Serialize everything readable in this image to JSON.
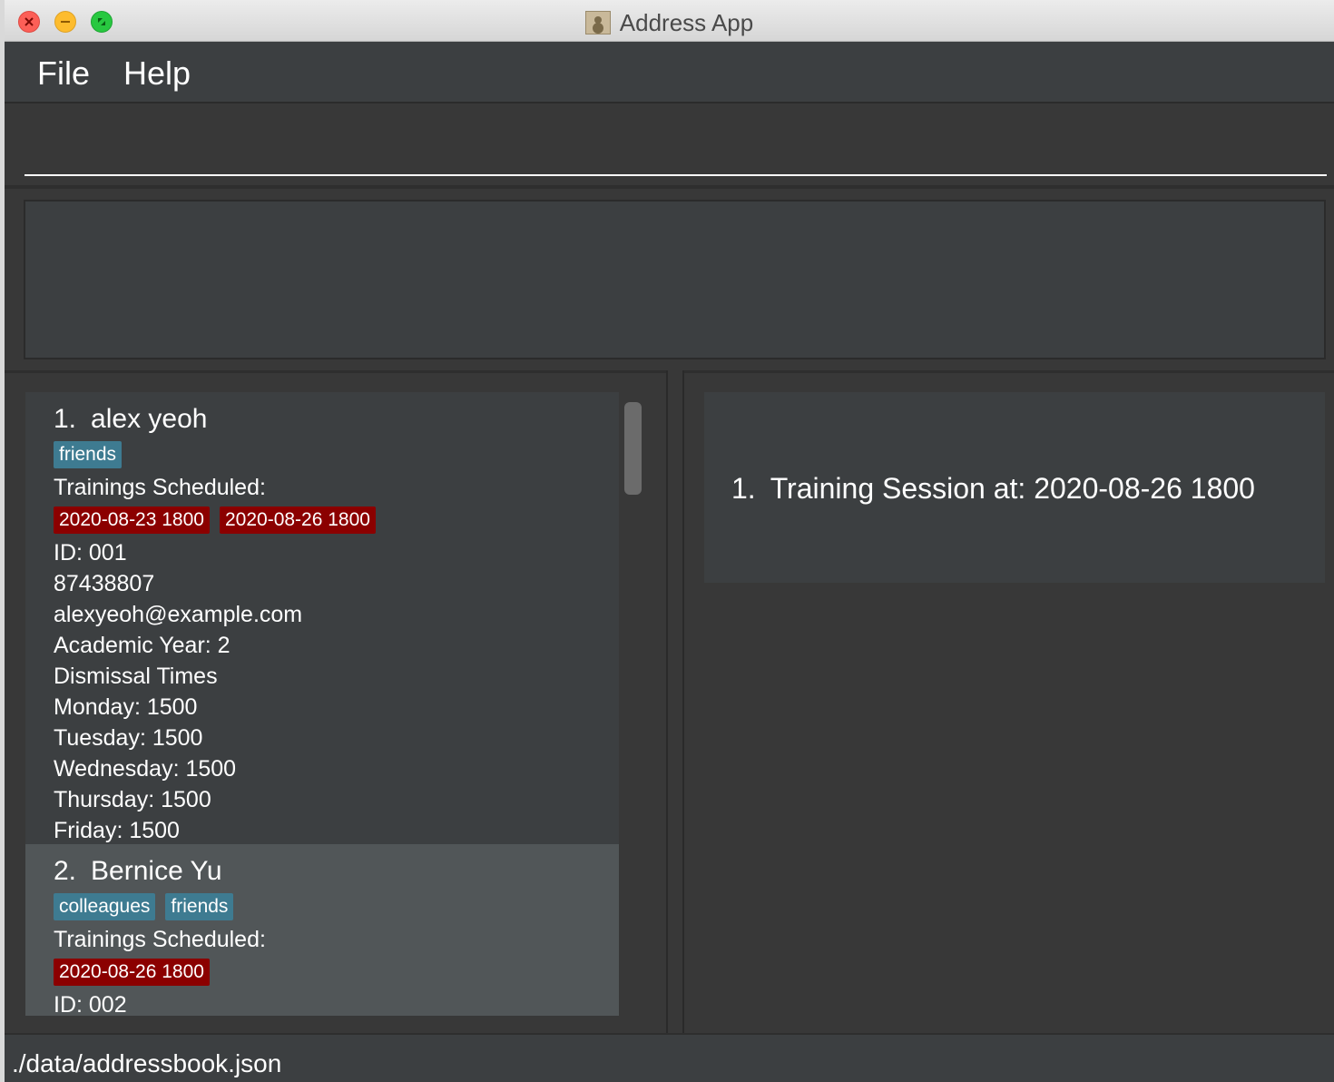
{
  "window": {
    "title": "Address App"
  },
  "menu": {
    "file": "File",
    "help": "Help"
  },
  "command_box": {
    "value": "",
    "placeholder": ""
  },
  "result_display": {
    "text": ""
  },
  "persons": [
    {
      "index": "1.",
      "name": "alex yeoh",
      "tags": [
        "friends"
      ],
      "trainings_label": "Trainings Scheduled:",
      "trainings": [
        "2020-08-23 1800",
        "2020-08-26 1800"
      ],
      "id": "ID: 001",
      "phone": "87438807",
      "email": "alexyeoh@example.com",
      "academic_year": "Academic Year: 2",
      "dismissal_label": "Dismissal Times",
      "dismissal": [
        "Monday: 1500",
        "Tuesday: 1500",
        "Wednesday: 1500",
        "Thursday: 1500",
        "Friday: 1500"
      ]
    },
    {
      "index": "2.",
      "name": "Bernice Yu",
      "tags": [
        "colleagues",
        "friends"
      ],
      "trainings_label": "Trainings Scheduled:",
      "trainings": [
        "2020-08-26 1800"
      ],
      "id": "ID: 002"
    }
  ],
  "sessions": [
    {
      "index": "1.",
      "text": "Training Session at: 2020-08-26 1800"
    }
  ],
  "status_bar": {
    "path": "./data/addressbook.json"
  },
  "colors": {
    "tag": "#3e7b91",
    "training_tag": "#8b0000",
    "selected_card": "#515658",
    "card": "#3c3f41"
  }
}
